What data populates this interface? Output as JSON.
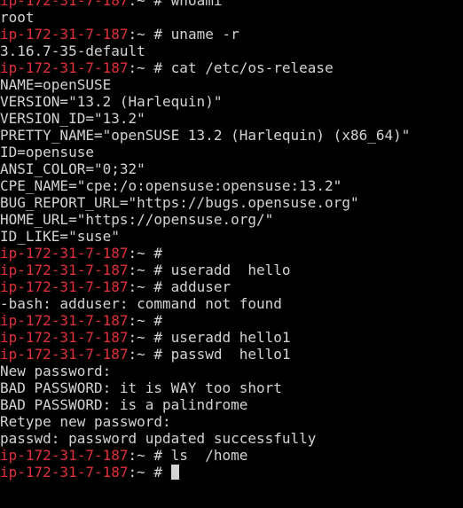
{
  "prompt": {
    "host": "ip-172-31-7-187",
    "path": ":~",
    "sign": " # "
  },
  "lines": [
    {
      "type": "cmd",
      "text": "whoami"
    },
    {
      "type": "out",
      "text": "root"
    },
    {
      "type": "cmd",
      "text": "uname -r"
    },
    {
      "type": "out",
      "text": "3.16.7-35-default"
    },
    {
      "type": "cmd",
      "text": "cat /etc/os-release"
    },
    {
      "type": "out",
      "text": "NAME=openSUSE"
    },
    {
      "type": "out",
      "text": "VERSION=\"13.2 (Harlequin)\""
    },
    {
      "type": "out",
      "text": "VERSION_ID=\"13.2\""
    },
    {
      "type": "out",
      "text": "PRETTY_NAME=\"openSUSE 13.2 (Harlequin) (x86_64)\""
    },
    {
      "type": "out",
      "text": "ID=opensuse"
    },
    {
      "type": "out",
      "text": "ANSI_COLOR=\"0;32\""
    },
    {
      "type": "out",
      "text": "CPE_NAME=\"cpe:/o:opensuse:opensuse:13.2\""
    },
    {
      "type": "out",
      "text": "BUG_REPORT_URL=\"https://bugs.opensuse.org\""
    },
    {
      "type": "out",
      "text": "HOME_URL=\"https://opensuse.org/\""
    },
    {
      "type": "out",
      "text": "ID_LIKE=\"suse\""
    },
    {
      "type": "cmd",
      "text": ""
    },
    {
      "type": "cmd",
      "text": "useradd  hello"
    },
    {
      "type": "cmd",
      "text": "adduser"
    },
    {
      "type": "out",
      "text": "-bash: adduser: command not found"
    },
    {
      "type": "cmd",
      "text": ""
    },
    {
      "type": "cmd",
      "text": "useradd hello1"
    },
    {
      "type": "cmd",
      "text": "passwd  hello1"
    },
    {
      "type": "out",
      "text": "New password:"
    },
    {
      "type": "out",
      "text": "BAD PASSWORD: it is WAY too short"
    },
    {
      "type": "out",
      "text": "BAD PASSWORD: is a palindrome"
    },
    {
      "type": "out",
      "text": "Retype new password:"
    },
    {
      "type": "out",
      "text": "passwd: password updated successfully"
    },
    {
      "type": "cmd",
      "text": "ls  /home"
    },
    {
      "type": "cmd",
      "text": "",
      "cursor": true
    }
  ],
  "colors": {
    "background": "#000000",
    "prompt_host": "#e0303a",
    "text": "#d3d3d3"
  }
}
